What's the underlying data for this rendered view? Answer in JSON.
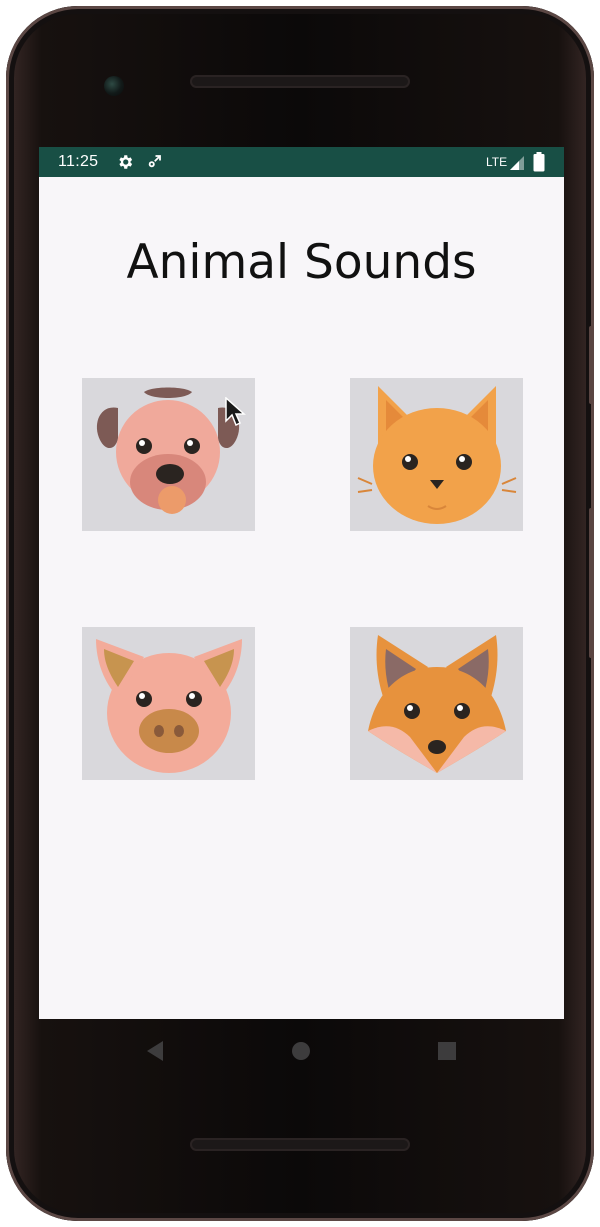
{
  "status_bar": {
    "time": "11:25",
    "network_label": "LTE",
    "icons": [
      "settings-icon",
      "gps-icon",
      "signal-icon",
      "battery-icon"
    ],
    "background_color": "#184f45"
  },
  "app": {
    "title": "Animal Sounds",
    "background_color": "#f8f6f9",
    "card_background_color": "#d9d8dc"
  },
  "animals": [
    {
      "name": "dog",
      "icon": "dog-face-icon"
    },
    {
      "name": "cat",
      "icon": "cat-face-icon"
    },
    {
      "name": "pig",
      "icon": "pig-face-icon"
    },
    {
      "name": "fox",
      "icon": "fox-face-icon"
    }
  ],
  "navigation": {
    "buttons": [
      "back-icon",
      "home-icon",
      "recents-icon"
    ]
  }
}
